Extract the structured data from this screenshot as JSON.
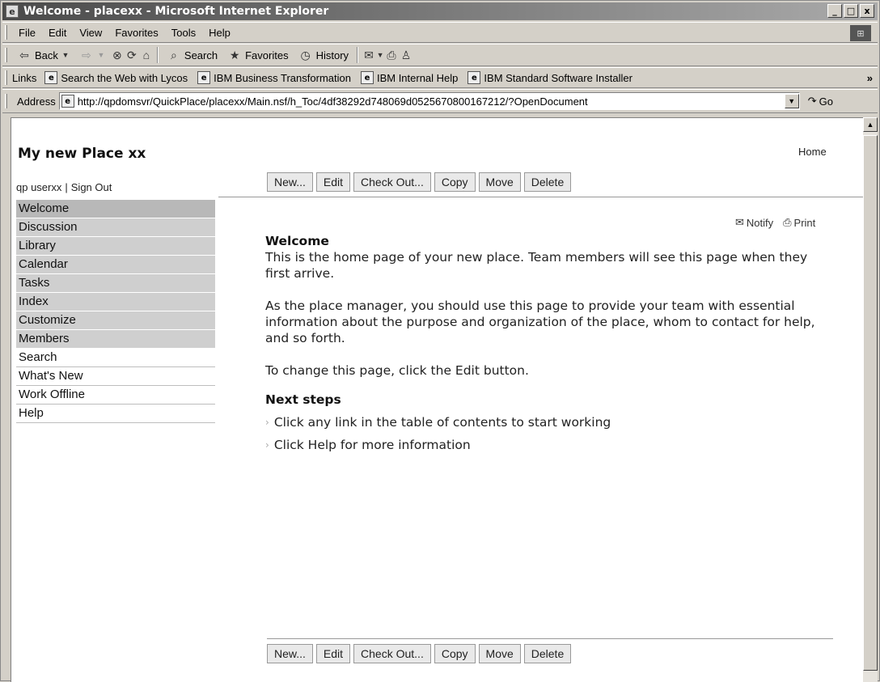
{
  "window": {
    "title": "Welcome - placexx - Microsoft Internet Explorer",
    "controls": [
      "_",
      "□",
      "x"
    ]
  },
  "menu": [
    "File",
    "Edit",
    "View",
    "Favorites",
    "Tools",
    "Help"
  ],
  "toolbar": {
    "back": "Back",
    "search": "Search",
    "favorites": "Favorites",
    "history": "History"
  },
  "links_bar": {
    "label": "Links",
    "items": [
      "Search the Web with Lycos",
      "IBM Business Transformation",
      "IBM Internal Help",
      "IBM Standard Software Installer"
    ],
    "more": "»"
  },
  "address_bar": {
    "label": "Address",
    "url": "http://qpdomsvr/QuickPlace/placexx/Main.nsf/h_Toc/4df38292d748069d0525670800167212/?OpenDocument",
    "go": "Go"
  },
  "page": {
    "place_title": "My new Place xx",
    "home_link": "Home",
    "user": "qp userxx",
    "sign_out": "Sign Out",
    "user_sep": "|",
    "buttons": [
      "New...",
      "Edit",
      "Check Out...",
      "Copy",
      "Move",
      "Delete"
    ],
    "toc": [
      {
        "label": "Welcome",
        "style": "gray"
      },
      {
        "label": "Discussion",
        "style": "gray"
      },
      {
        "label": "Library",
        "style": "gray"
      },
      {
        "label": "Calendar",
        "style": "gray"
      },
      {
        "label": "Tasks",
        "style": "gray"
      },
      {
        "label": "Index",
        "style": "gray"
      },
      {
        "label": "Customize",
        "style": "gray"
      },
      {
        "label": "Members",
        "style": "gray"
      },
      {
        "label": "Search",
        "style": "white"
      },
      {
        "label": "What's New",
        "style": "white"
      },
      {
        "label": "Work Offline",
        "style": "white"
      },
      {
        "label": "Help",
        "style": "white"
      }
    ],
    "notify": "Notify",
    "print": "Print",
    "content": {
      "heading": "Welcome",
      "para1": "This is the home page of your new place. Team members will see this page when they first arrive.",
      "para2": "As the place manager, you should use this page to provide your team with essential information about the purpose and organization of the place, whom to contact for help, and so forth.",
      "para3": "To change this page, click the Edit button.",
      "next_heading": "Next steps",
      "steps": [
        "Click any link in the table of contents to start working",
        "Click Help for more information"
      ]
    }
  }
}
